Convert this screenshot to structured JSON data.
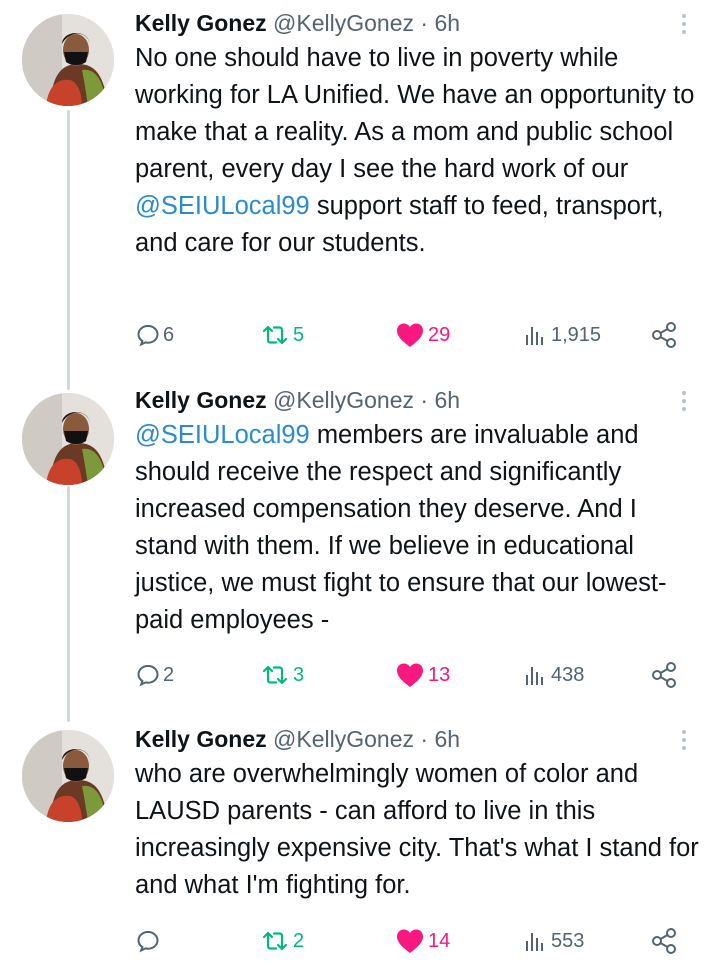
{
  "colors": {
    "text": "#0f1419",
    "secondary": "#536471",
    "mention": "#2a8bd0",
    "retweet_green": "#00ba7c",
    "like_pink": "#f91880",
    "thread_line": "#cfd9de"
  },
  "tweets": [
    {
      "author": {
        "name": "Kelly Gonez",
        "handle": "@KellyGonez",
        "separator": "·",
        "time": "6h"
      },
      "text": {
        "pre": "No one should have to live in poverty while working for LA Unified. We have an opportunity to make that a reality. As a mom and public school parent, every day I see the hard work of our ",
        "mention": "@SEIULocal99",
        "post": " support staff to feed, transport, and care for our students."
      },
      "stats": {
        "replies": "6",
        "retweets": "5",
        "likes": "29",
        "views": "1,915"
      },
      "icons": [
        "more-icon",
        "reply-icon",
        "retweet-icon",
        "like-icon",
        "views-icon",
        "share-icon"
      ]
    },
    {
      "author": {
        "name": "Kelly Gonez",
        "handle": "@KellyGonez",
        "separator": "·",
        "time": "6h"
      },
      "text": {
        "pre": "",
        "mention": "@SEIULocal99",
        "post": " members are invaluable and should receive the respect and significantly increased compensation they deserve. And I stand with them. If we believe in educational justice, we must fight to ensure that our lowest-paid employees -"
      },
      "stats": {
        "replies": "2",
        "retweets": "3",
        "likes": "13",
        "views": "438"
      },
      "icons": [
        "more-icon",
        "reply-icon",
        "retweet-icon",
        "like-icon",
        "views-icon",
        "share-icon"
      ]
    },
    {
      "author": {
        "name": "Kelly Gonez",
        "handle": "@KellyGonez",
        "separator": "·",
        "time": "6h"
      },
      "text": {
        "pre": "who are overwhelmingly women of color and LAUSD parents - can afford to live in this increasingly expensive city. That's what I stand for and what I'm fighting for.",
        "mention": "",
        "post": ""
      },
      "stats": {
        "replies": "",
        "retweets": "2",
        "likes": "14",
        "views": "553"
      },
      "icons": [
        "more-icon",
        "reply-icon",
        "retweet-icon",
        "like-icon",
        "views-icon",
        "share-icon"
      ]
    }
  ]
}
